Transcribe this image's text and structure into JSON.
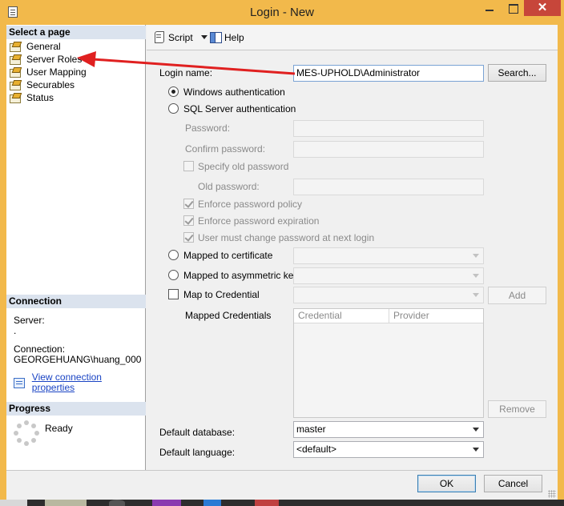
{
  "window": {
    "title": "Login - New",
    "close_glyph": "✕"
  },
  "left_panel": {
    "select_page_heading": "Select a page",
    "pages": [
      {
        "label": "General",
        "icon": "page-wrench-icon"
      },
      {
        "label": "Server Roles",
        "icon": "page-wrench-icon"
      },
      {
        "label": "User Mapping",
        "icon": "page-wrench-icon"
      },
      {
        "label": "Securables",
        "icon": "page-wrench-icon"
      },
      {
        "label": "Status",
        "icon": "page-wrench-icon"
      }
    ],
    "connection_heading": "Connection",
    "server_label": "Server:",
    "server_value": ".",
    "connection_label": "Connection:",
    "connection_value": "GEORGEHUANG\\huang_000",
    "view_connection_link": "View connection properties",
    "progress_heading": "Progress",
    "progress_status": "Ready"
  },
  "toolbar": {
    "script_label": "Script",
    "help_label": "Help"
  },
  "form": {
    "login_name_label": "Login name:",
    "login_name_value": "MES-UPHOLD\\Administrator",
    "search_button": "Search...",
    "windows_auth": "Windows authentication",
    "sql_auth": "SQL Server authentication",
    "password_label": "Password:",
    "confirm_password_label": "Confirm password:",
    "specify_old_password": "Specify old password",
    "old_password_label": "Old password:",
    "enforce_policy": "Enforce password policy",
    "enforce_expiration": "Enforce password expiration",
    "must_change": "User must change password at next login",
    "mapped_to_certificate": "Mapped to certificate",
    "mapped_to_asymmetric_key": "Mapped to asymmetric key",
    "map_to_credential": "Map to Credential",
    "add_button": "Add",
    "mapped_credentials_label": "Mapped Credentials",
    "credentials_columns": [
      "Credential",
      "Provider"
    ],
    "remove_button": "Remove",
    "default_database_label": "Default database:",
    "default_database_value": "master",
    "default_language_label": "Default language:",
    "default_language_value": "<default>"
  },
  "footer": {
    "ok_button": "OK",
    "cancel_button": "Cancel"
  },
  "colors": {
    "title_bar": "#f2b94b",
    "close_button": "#c7463a",
    "annotation_arrow": "#e02020",
    "link": "#1a44c4"
  }
}
